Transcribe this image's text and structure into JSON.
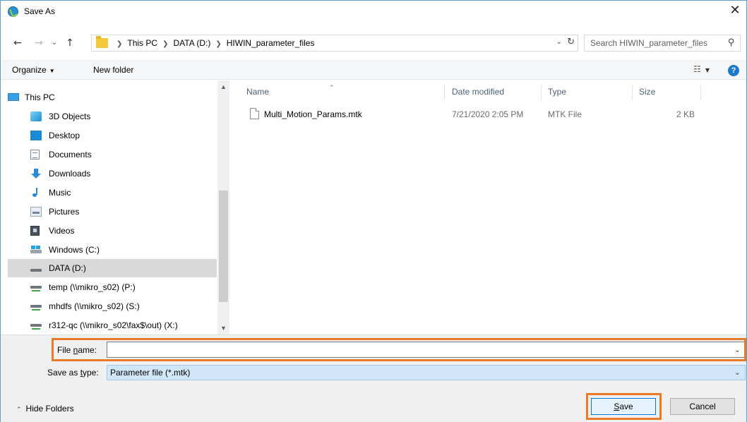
{
  "window": {
    "title": "Save As",
    "close_glyph": "✕"
  },
  "address": {
    "crumbs": [
      "This PC",
      "DATA (D:)",
      "HIWIN_parameter_files"
    ],
    "search_placeholder": "Search HIWIN_parameter_files"
  },
  "toolbar": {
    "organize": "Organize",
    "new_folder": "New folder"
  },
  "nav": {
    "items": [
      {
        "label": "This PC",
        "icon": "pc-icon"
      },
      {
        "label": "3D Objects",
        "icon": "3d-objects-icon"
      },
      {
        "label": "Desktop",
        "icon": "desktop-icon"
      },
      {
        "label": "Documents",
        "icon": "documents-icon"
      },
      {
        "label": "Downloads",
        "icon": "downloads-icon"
      },
      {
        "label": "Music",
        "icon": "music-icon"
      },
      {
        "label": "Pictures",
        "icon": "pictures-icon"
      },
      {
        "label": "Videos",
        "icon": "videos-icon"
      },
      {
        "label": "Windows (C:)",
        "icon": "windows-drive-icon"
      },
      {
        "label": "DATA (D:)",
        "icon": "drive-icon",
        "selected": true
      },
      {
        "label": "temp (\\\\mikro_s02) (P:)",
        "icon": "network-drive-icon"
      },
      {
        "label": "mhdfs (\\\\mikro_s02) (S:)",
        "icon": "network-drive-icon"
      },
      {
        "label": "r312-qc (\\\\mikro_s02\\fax$\\out) (X:)",
        "icon": "network-drive-icon"
      }
    ]
  },
  "files": {
    "columns": [
      "Name",
      "Date modified",
      "Type",
      "Size"
    ],
    "rows": [
      {
        "name": "Multi_Motion_Params.mtk",
        "date": "7/21/2020 2:05 PM",
        "type": "MTK File",
        "size": "2 KB"
      }
    ]
  },
  "form": {
    "file_name_label_pre": "File ",
    "file_name_label_u": "n",
    "file_name_label_post": "ame:",
    "file_name_value": "",
    "save_type_label_pre": "Save as ",
    "save_type_label_u": "t",
    "save_type_label_post": "ype:",
    "save_type_value": "Parameter file (*.mtk)"
  },
  "footer": {
    "hide_folders": "Hide Folders",
    "save_u": "S",
    "save_rest": "ave",
    "cancel": "Cancel"
  },
  "colors": {
    "highlight": "#e87a2b",
    "accent": "#0078d7",
    "selection": "#d9d9d9"
  }
}
